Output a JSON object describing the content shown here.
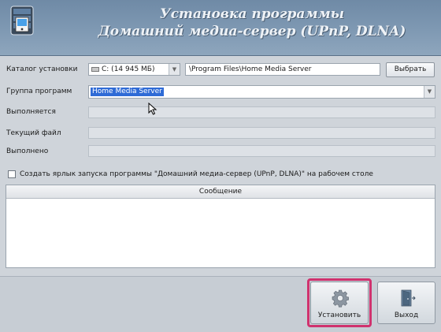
{
  "header": {
    "title_line1": "Установка программы",
    "title_line2": "Домашний медиа-сервер (UPnP, DLNA)"
  },
  "form": {
    "install_dir_label": "Каталог установки",
    "drive_value": "C: (14 945 МБ)",
    "path_value": "\\Program Files\\Home Media Server",
    "browse_label": "Выбрать",
    "group_label": "Группа программ",
    "group_value": "Home Media Server",
    "running_label": "Выполняется",
    "current_file_label": "Текущий файл",
    "done_label": "Выполнено"
  },
  "shortcut": {
    "label": "Создать ярлык запуска программы \"Домашний медиа-сервер (UPnP, DLNA)\" на рабочем столе",
    "checked": false
  },
  "messages": {
    "header": "Сообщение",
    "rows": []
  },
  "buttons": {
    "install_label": "Установить",
    "exit_label": "Выход"
  },
  "icons": {
    "logo": "media-server-logo-icon",
    "drive": "hard-drive-icon",
    "install": "gear-icon",
    "exit": "exit-door-icon"
  },
  "colors": {
    "header": "#7f99b3",
    "selection": "#2f6bd6",
    "highlight": "#d0326e"
  }
}
